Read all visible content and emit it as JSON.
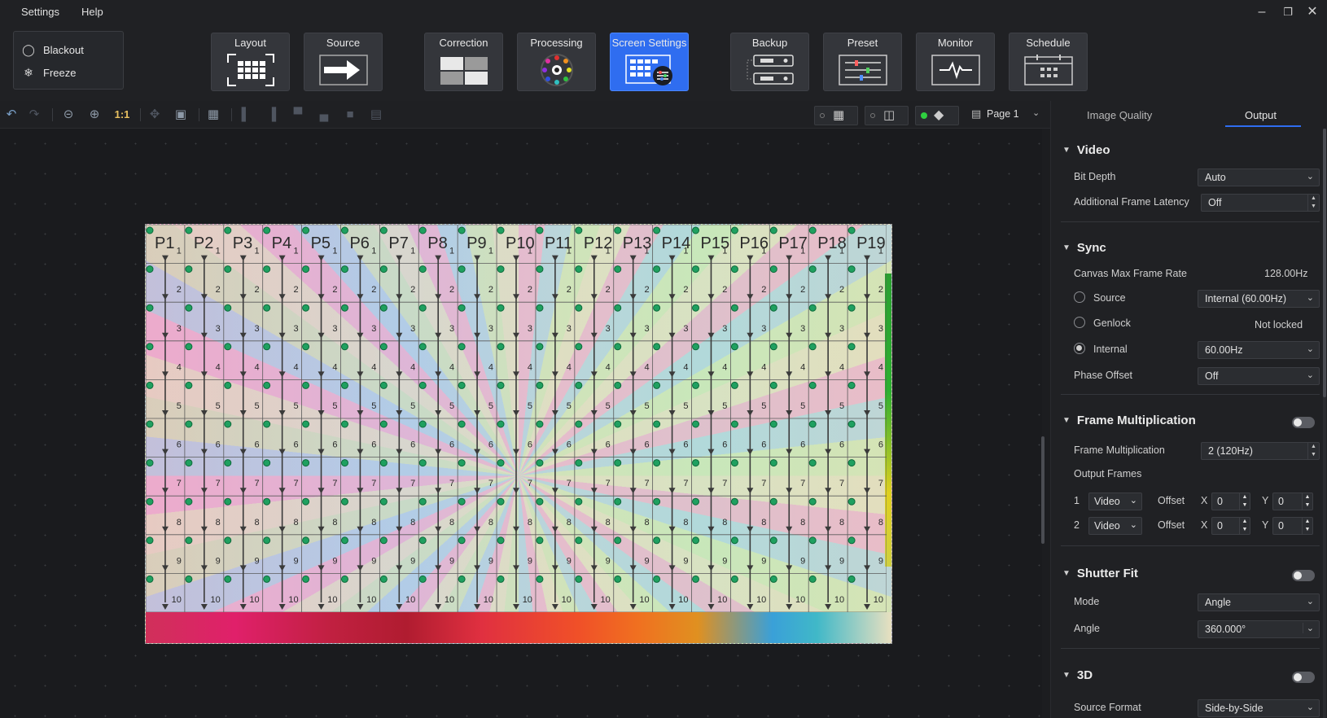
{
  "menu": {
    "settings": "Settings",
    "help": "Help"
  },
  "quick": {
    "blackout": "Blackout",
    "freeze": "Freeze"
  },
  "toolbar": {
    "layout": "Layout",
    "source": "Source",
    "correction": "Correction",
    "processing": "Processing",
    "screen_settings": "Screen Settings",
    "backup": "Backup",
    "preset": "Preset",
    "monitor": "Monitor",
    "schedule": "Schedule"
  },
  "canvas_toolbar": {
    "zoom_1to1": "1:1",
    "page": "Page 1"
  },
  "screen": {
    "port_labels": [
      "P1",
      "P2",
      "P3",
      "P4",
      "P5",
      "P6",
      "P7",
      "P8",
      "P9",
      "P10",
      "P11",
      "P12",
      "P13",
      "P14",
      "P15",
      "P16",
      "P17",
      "P18",
      "P19"
    ],
    "row_labels": [
      "1",
      "2",
      "3",
      "4",
      "5",
      "6",
      "7",
      "8",
      "9",
      "10"
    ]
  },
  "panel": {
    "tabs": {
      "image_quality": "Image Quality",
      "output": "Output"
    },
    "video": {
      "title": "Video",
      "bit_depth_label": "Bit Depth",
      "bit_depth": "Auto",
      "latency_label": "Additional Frame Latency",
      "latency": "Off"
    },
    "sync": {
      "title": "Sync",
      "max_rate_label": "Canvas Max Frame Rate",
      "max_rate": "128.00Hz",
      "source_label": "Source",
      "source_value": "Internal (60.00Hz)",
      "genlock_label": "Genlock",
      "genlock_value": "Not locked",
      "internal_label": "Internal",
      "internal_value": "60.00Hz",
      "phase_label": "Phase Offset",
      "phase_value": "Off"
    },
    "frame_mult": {
      "title": "Frame Multiplication",
      "label": "Frame Multiplication",
      "value": "2 (120Hz)",
      "output_frames_label": "Output Frames",
      "rows": [
        {
          "index": "1",
          "type": "Video",
          "offset_label": "Offset",
          "x_label": "X",
          "x": "0",
          "y_label": "Y",
          "y": "0"
        },
        {
          "index": "2",
          "type": "Video",
          "offset_label": "Offset",
          "x_label": "X",
          "x": "0",
          "y_label": "Y",
          "y": "0"
        }
      ]
    },
    "shutter": {
      "title": "Shutter Fit",
      "mode_label": "Mode",
      "mode": "Angle",
      "angle_label": "Angle",
      "angle": "360.000°"
    },
    "three_d": {
      "title": "3D",
      "source_format_label": "Source Format",
      "source_format": "Side-by-Side"
    }
  }
}
